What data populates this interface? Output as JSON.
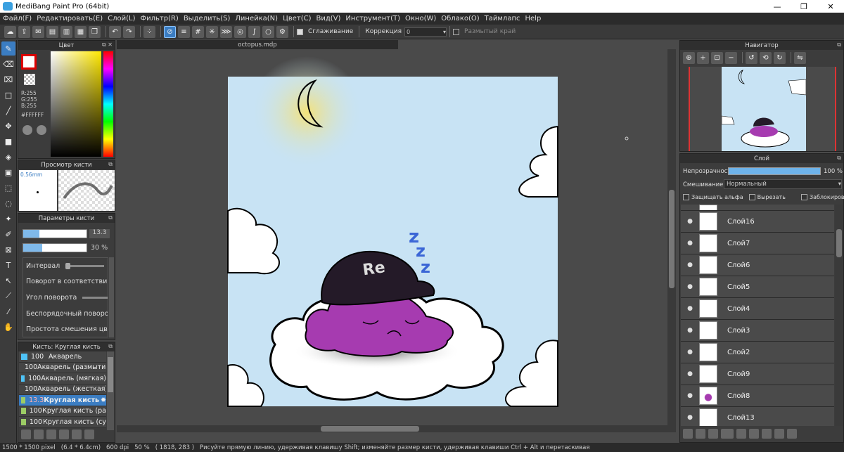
{
  "window": {
    "title": "MediBang Paint Pro (64bit)",
    "minimize": "—",
    "maximize": "❐",
    "close": "✕"
  },
  "menu": [
    "Файл(F)",
    "Редактировать(E)",
    "Слой(L)",
    "Фильтр(R)",
    "Выделить(S)",
    "Линейка(N)",
    "Цвет(C)",
    "Вид(V)",
    "Инструмент(T)",
    "Окно(W)",
    "Облако(O)",
    "Таймлапс",
    "Help"
  ],
  "toolbar": {
    "smoothing_label": "Сглаживание",
    "correction_label": "Коррекция",
    "correction_value": "0",
    "blur_edge_label": "Размытый край"
  },
  "color_panel": {
    "title": "Цвет",
    "r": "R:255",
    "g": "G:255",
    "b": "B:255",
    "hex": "#FFFFFF"
  },
  "brush_preview": {
    "title": "Просмотр кисти",
    "size": "0.56mm"
  },
  "brush_params": {
    "title": "Параметры кисти",
    "size_value": "13.3",
    "opacity_value": "30 %",
    "size_fill": 0.45,
    "opacity_fill": 0.3,
    "rows": [
      "Интервал",
      "Поворот в соответствии",
      "Угол поворота",
      "Беспорядочный поворот",
      "Простота смешения цвета"
    ]
  },
  "brush_list": {
    "title": "Кисть: Круглая кисть",
    "items": [
      {
        "num": "100",
        "name": "Акварель",
        "color": "#4fc3f7"
      },
      {
        "num": "100",
        "name": "Акварель (размытие)",
        "color": "#4fc3f7"
      },
      {
        "num": "100",
        "name": "Акварель (мягкая)",
        "color": "#4fc3f7"
      },
      {
        "num": "100",
        "name": "Акварель (жесткая)",
        "color": "#4fc3f7"
      },
      {
        "num": "13.3",
        "name": "Круглая кисть",
        "color": "#9ccc65"
      },
      {
        "num": "100",
        "name": "Круглая кисть (ра",
        "color": "#9ccc65"
      },
      {
        "num": "100",
        "name": "Круглая кисть (су",
        "color": "#9ccc65"
      }
    ]
  },
  "document": {
    "tab": "octopus.mdp"
  },
  "navigator": {
    "title": "Навигатор"
  },
  "layers": {
    "title": "Слой",
    "opacity_label": "Непрозрачность",
    "opacity_value": "100 %",
    "opacity_fill": 1.0,
    "blend_label": "Смешивание",
    "blend_value": "Нормальный",
    "protect_alpha": "Защищать альфа",
    "clip": "Вырезать",
    "lock": "Заблокировать",
    "items": [
      "Слой16",
      "Слой7",
      "Слой6",
      "Слой5",
      "Слой4",
      "Слой3",
      "Слой2",
      "Слой9",
      "Слой8",
      "Слой13"
    ]
  },
  "status": {
    "size": "1500 * 1500 pixel",
    "dims": "(6.4 * 6.4cm)",
    "dpi": "600 dpi",
    "zoom": "50 %",
    "coords": "( 1818, 283 )",
    "hint": "Рисуйте прямую линию, удерживая клавишу Shift; изменяйте размер кисти, удерживая клавиши Ctrl + Alt и перетаскивая"
  },
  "artwork": {
    "cap_text": "Re",
    "zzz": [
      "z",
      "z",
      "z"
    ]
  }
}
